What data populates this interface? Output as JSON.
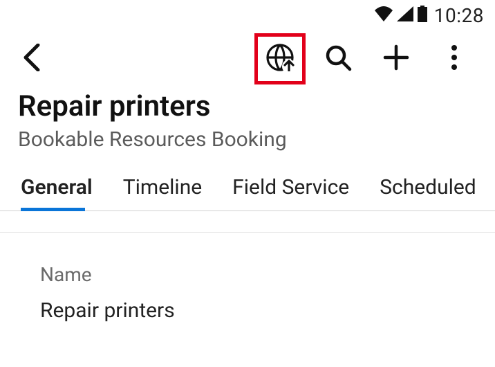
{
  "status": {
    "time": "10:28"
  },
  "header": {
    "title": "Repair printers",
    "subtitle": "Bookable Resources Booking"
  },
  "tabs": [
    {
      "label": "General",
      "active": true
    },
    {
      "label": "Timeline",
      "active": false
    },
    {
      "label": "Field Service",
      "active": false
    },
    {
      "label": "Scheduled",
      "active": false
    }
  ],
  "fields": {
    "name": {
      "label": "Name",
      "value": "Repair printers"
    }
  },
  "icons": {
    "globe_upload": "globe-upload-icon",
    "search": "search-icon",
    "add": "plus-icon",
    "more": "more-vertical-icon",
    "back": "chevron-left-icon",
    "wifi": "wifi-icon",
    "signal": "signal-icon",
    "battery": "battery-icon"
  },
  "colors": {
    "highlight_border": "#e2001a",
    "tab_underline": "#0a75d8"
  }
}
